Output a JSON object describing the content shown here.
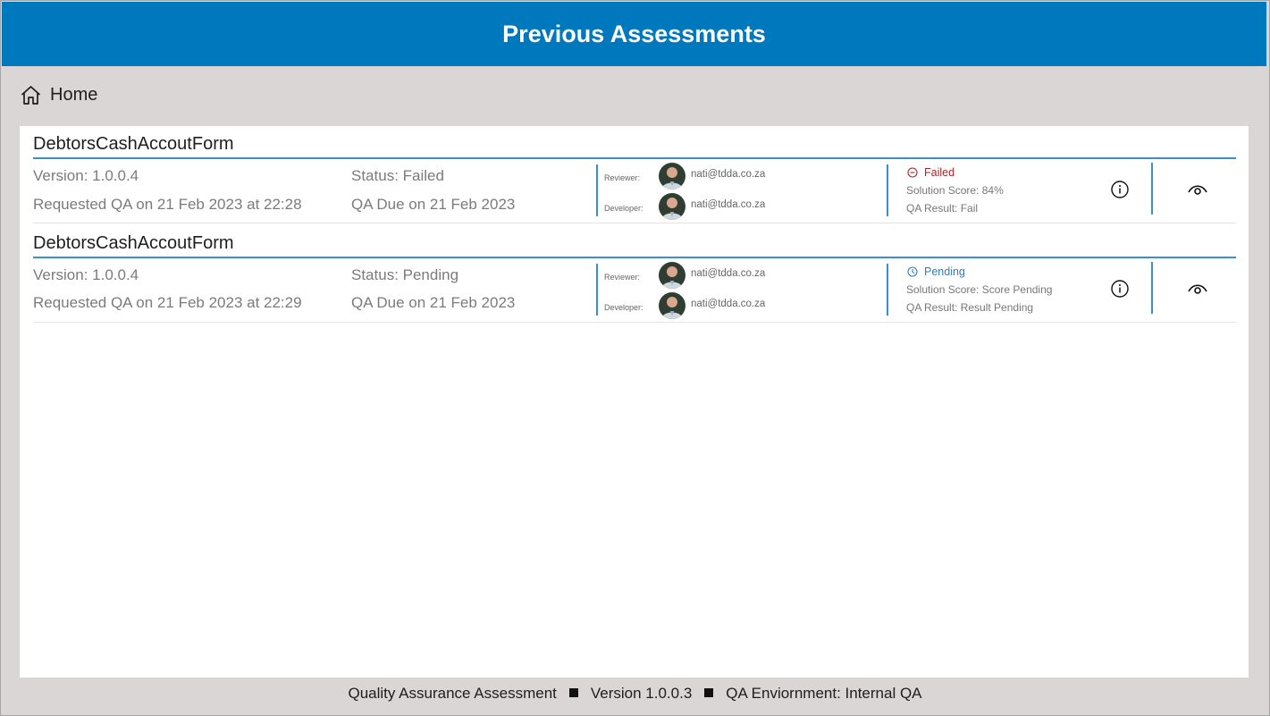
{
  "header": {
    "title": "Previous Assessments",
    "bg_color": "#0078bd"
  },
  "nav": {
    "home_label": "Home",
    "home_icon": "home-icon"
  },
  "assessments": [
    {
      "name": "DebtorsCashAccoutForm",
      "version": "Version: 1.0.0.4",
      "status": "Status: Failed",
      "requested": "Requested QA on 21 Feb 2023 at 22:28",
      "due": "QA Due on 21 Feb 2023",
      "reviewer_label": "Reviewer:",
      "reviewer_email": "nati@tdda.co.za",
      "developer_label": "Developer:",
      "developer_email": "nati@tdda.co.za",
      "result_status": "Failed",
      "result_status_color": "#a4262c",
      "result_status_icon": "minus-circle-icon",
      "solution_score": "Solution Score: 84%",
      "qa_result": "QA Result: Fail"
    },
    {
      "name": "DebtorsCashAccoutForm",
      "version": "Version: 1.0.0.4",
      "status": "Status: Pending",
      "requested": "Requested QA on 21 Feb 2023 at 22:29",
      "due": "QA Due on 21 Feb 2023",
      "reviewer_label": "Reviewer:",
      "reviewer_email": "nati@tdda.co.za",
      "developer_label": "Developer:",
      "developer_email": "nati@tdda.co.za",
      "result_status": "Pending",
      "result_status_color": "#2e7dc3",
      "result_status_icon": "clock-icon",
      "solution_score": "Solution Score: Score Pending",
      "qa_result": "QA Result: Result Pending"
    }
  ],
  "footer": {
    "app_name": "Quality Assurance Assessment",
    "version": "Version 1.0.0.3",
    "environment": "QA Enviornment: Internal QA"
  },
  "colors": {
    "accent": "#3b8fcf",
    "background": "#d9d6d5",
    "failed": "#a4262c",
    "pending": "#2e7dc3"
  }
}
